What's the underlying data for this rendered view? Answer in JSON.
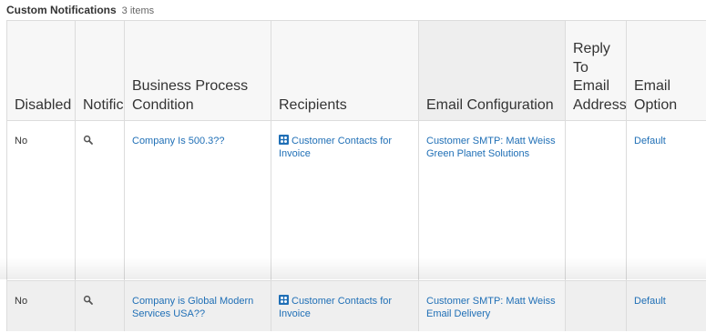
{
  "header": {
    "title": "Custom Notifications",
    "count": "3 items"
  },
  "columns": [
    "Disabled",
    "Notific",
    "Business Process Condition",
    "Recipients",
    "Email Configuration",
    "Reply To Email Address",
    "Email Option"
  ],
  "rows": [
    {
      "disabled": "No",
      "notification_icon": "search-icon",
      "condition": "Company Is 500.3??",
      "recipient_icon": "people-group-icon",
      "recipients": "Customer Contacts for Invoice",
      "email_configuration": "Customer SMTP: Matt Weiss Green Planet Solutions",
      "reply_to": "",
      "email_option": "Default"
    },
    {
      "disabled": "No",
      "notification_icon": "search-icon",
      "condition": "Company is Global Modern Services USA??",
      "recipient_icon": "people-group-icon",
      "recipients": "Customer Contacts for Invoice",
      "email_configuration": "Customer SMTP: Matt Weiss Email Delivery",
      "reply_to": "",
      "email_option": "Default"
    }
  ],
  "colors": {
    "link": "#1f6fb6",
    "header_bg": "#f7f7f7",
    "border": "#dcdcdc"
  }
}
